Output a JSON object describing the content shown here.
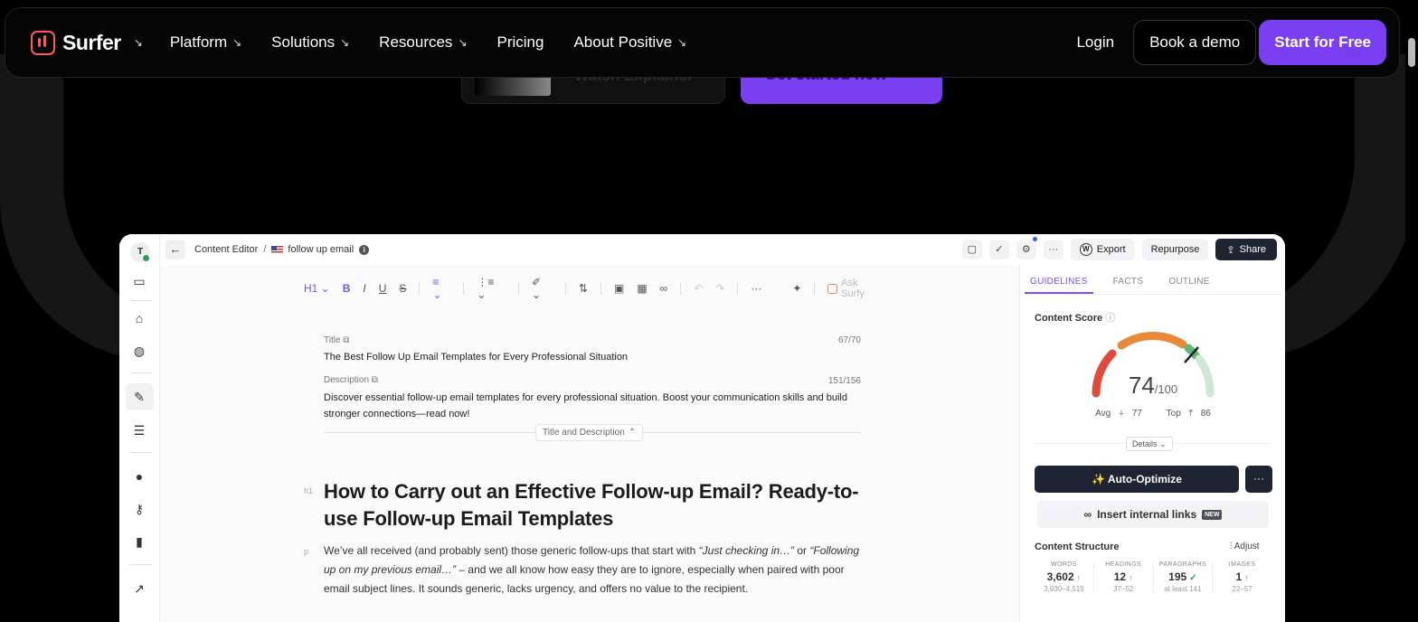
{
  "nav": {
    "logo_text": "Surfer",
    "logo_arrow": "↘",
    "links": [
      {
        "label": "Platform",
        "arrow": "↘"
      },
      {
        "label": "Solutions",
        "arrow": "↘"
      },
      {
        "label": "Resources",
        "arrow": "↘"
      },
      {
        "label": "Pricing",
        "arrow": ""
      },
      {
        "label": "About Positive",
        "arrow": "↘"
      }
    ],
    "login": "Login",
    "demo": "Book a demo",
    "cta": "Start for Free",
    "cta_color": "#7b3ff2"
  },
  "hero": {
    "video_label": "Watch Explainer",
    "cta_label": "Get started now"
  },
  "app": {
    "avatar_initial": "T",
    "breadcrumb_root": "Content Editor",
    "breadcrumb_sep": "/",
    "breadcrumb_doc": "follow up email",
    "export": "Export",
    "repurpose": "Repurpose",
    "share": "Share",
    "toolbar": {
      "heading": "H1",
      "ask": "Ask Surfy"
    },
    "title_label": "Title",
    "title_count": "67/70",
    "title_value": "The Best Follow Up Email Templates for Every Professional Situation",
    "desc_label": "Description",
    "desc_count": "151/156",
    "desc_value": "Discover essential follow-up email templates for every professional situation. Boost your communication skills and build stronger connections—read now!",
    "td_toggle": "Title and Description",
    "h1_tag": "h1",
    "h1_text": "How to Carry out an Effective Follow-up Email? Ready-to-use Follow-up Email Templates",
    "p_tag": "p",
    "para_start": "We’ve all received (and probably sent) those generic follow-ups that start with ",
    "para_q1": "“Just checking in…”",
    "para_or": " or ",
    "para_q2": "“Following up on my previous email…”",
    "para_end": " – and we all know how easy they are to ignore, especially when paired with poor email subject lines. It sounds generic, lacks urgency, and offers no value to the recipient."
  },
  "panel": {
    "tabs": [
      "GUIDELINES",
      "FACTS",
      "OUTLINE"
    ],
    "content_score_label": "Content Score",
    "score": "74",
    "score_max": "/100",
    "score_value": 74,
    "avg_label": "Avg",
    "avg_value": "77",
    "top_label": "Top",
    "top_value": "86",
    "details": "Details",
    "auto_optimize": "✨ Auto-Optimize",
    "more": "···",
    "internal_links": "Insert internal links",
    "new_badge": "NEW",
    "structure_label": "Content Structure",
    "adjust": "Adjust",
    "stats": [
      {
        "head": "WORDS",
        "value": "3,602",
        "mark": "↑",
        "range": "3,930–4,519"
      },
      {
        "head": "HEADINGS",
        "value": "12",
        "mark": "↑",
        "range": "37–52"
      },
      {
        "head": "PARAGRAPHS",
        "value": "195",
        "mark": "✓",
        "range": "at least 141"
      },
      {
        "head": "IMAGES",
        "value": "1",
        "mark": "↑",
        "range": "22–57"
      }
    ]
  }
}
